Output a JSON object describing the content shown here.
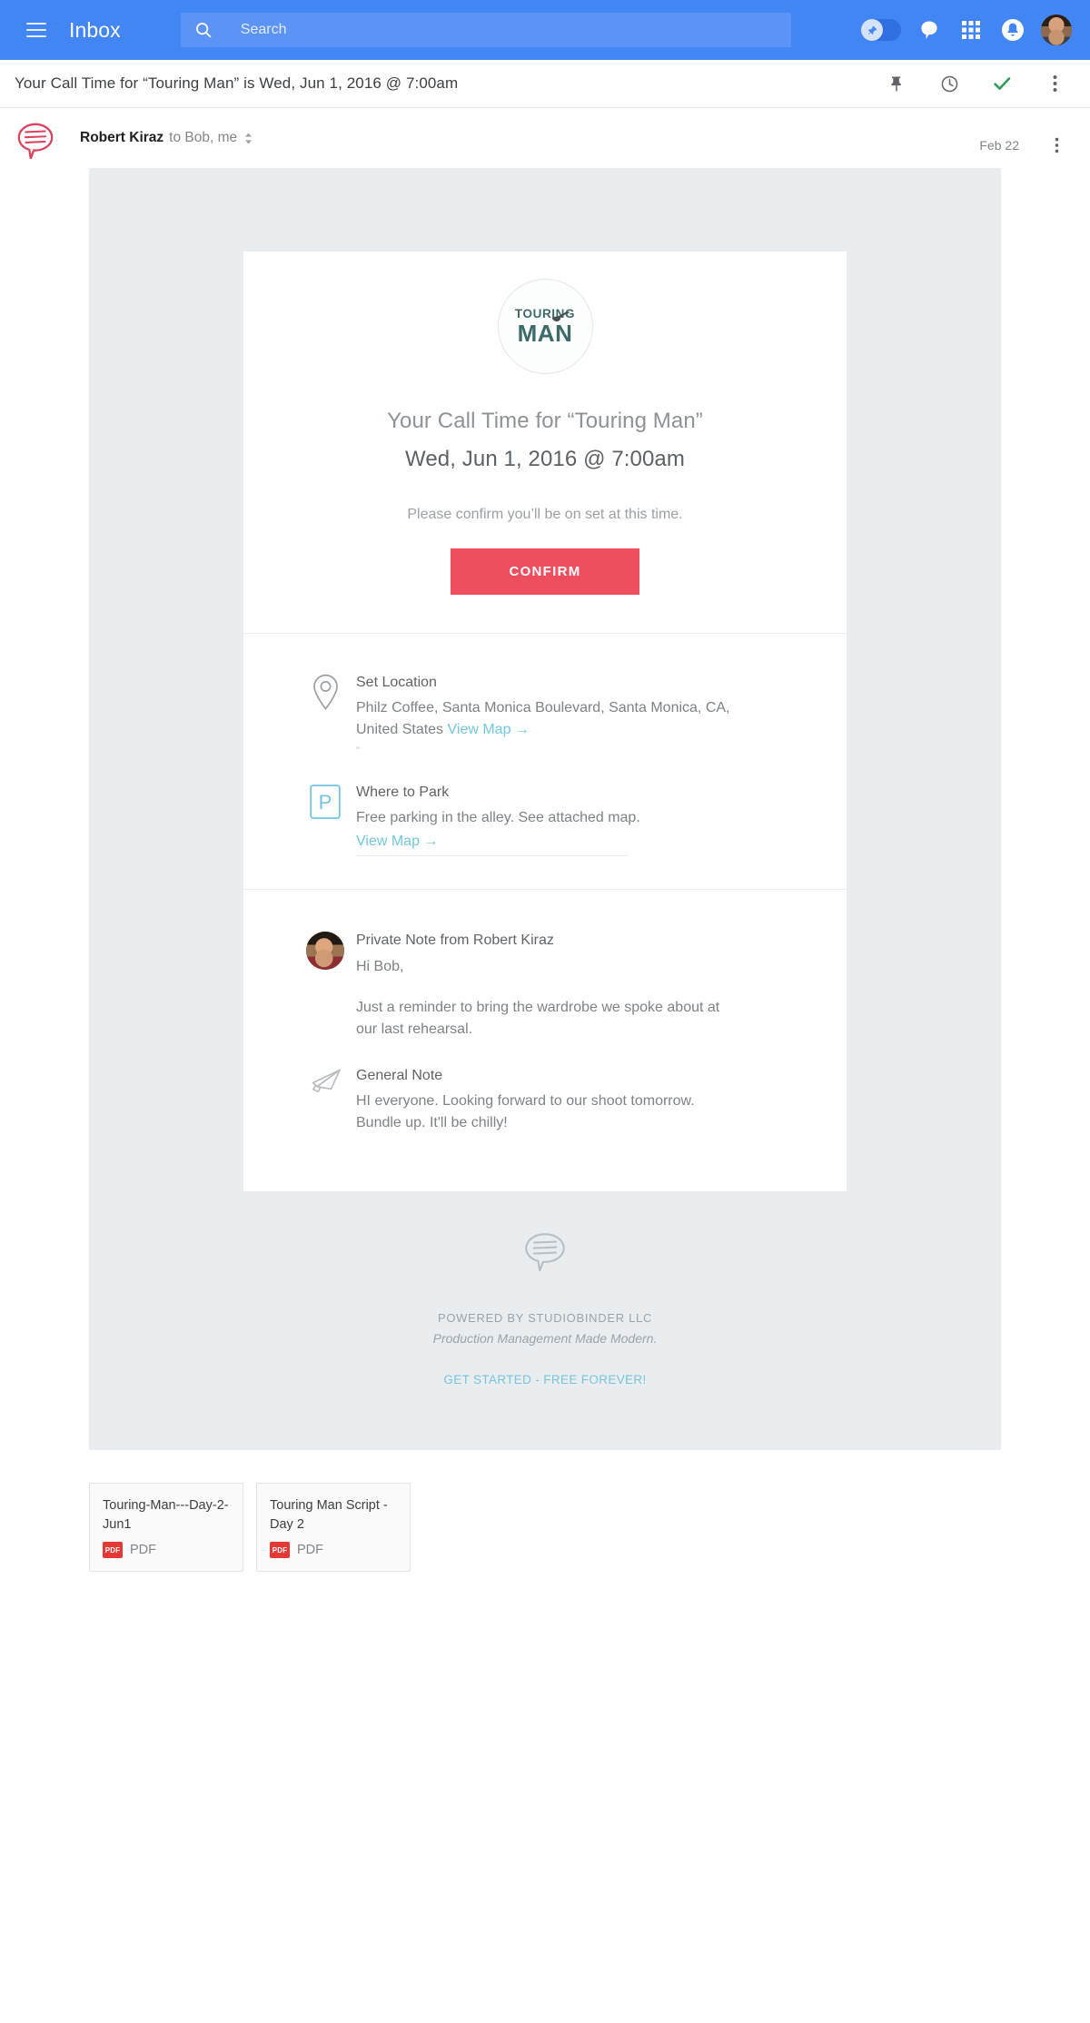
{
  "topbar": {
    "menu_icon": "hamburger-icon",
    "app_title": "Inbox",
    "search": {
      "icon": "search-icon",
      "placeholder": "Search",
      "value": ""
    },
    "pin_toggle": {
      "icon": "pin-icon",
      "state": "on"
    },
    "hangouts_icon": "chat-bubble-icon",
    "apps_icon": "apps-grid-icon",
    "notifications_icon": "bell-icon",
    "account_avatar": "user-avatar",
    "brand_color": "#4285f4"
  },
  "subject_bar": {
    "title": "Your Call Time for “Touring Man” is Wed, Jun 1, 2016 @ 7:00am",
    "actions": [
      {
        "name": "pin-icon",
        "label": "Pin"
      },
      {
        "name": "snooze-clock-icon",
        "label": "Snooze"
      },
      {
        "name": "done-check-icon",
        "label": "Done",
        "color": "#2e9e5b"
      },
      {
        "name": "more-options-icon",
        "label": "More"
      }
    ]
  },
  "message": {
    "sender_avatar": "studiobinder-bubble-logo",
    "sender_name": "Robert Kiraz",
    "recipients": "to Bob, me",
    "expand_icon": "expand-details-icon",
    "date": "Feb 22",
    "more_icon": "more-options-icon"
  },
  "email": {
    "background_color": "#e9edf0",
    "logo": {
      "line1": "TOURING",
      "line2": "MAN",
      "accent": "#3d6b69",
      "icon": "guitar-icon"
    },
    "headline": "Your Call Time for “Touring Man”",
    "headline_date": "Wed, Jun 1, 2016 @ 7:00am",
    "confirm_prompt": "Please confirm you’ll be on set at this time.",
    "confirm_button": "CONFIRM",
    "confirm_button_color": "#ef4e5e",
    "link_color": "#72c6dd",
    "info_rows": [
      {
        "icon": "map-pin-icon",
        "title": "Set Location",
        "text": "Philz Coffee, Santa Monica Boulevard, Santa Monica, CA, United States ",
        "link": "View Map →",
        "footnote": "\""
      },
      {
        "icon": "parking-p-icon",
        "title": "Where to Park",
        "text": "Free parking in the alley. See attached map.",
        "link": "View Map →"
      }
    ],
    "notes": [
      {
        "icon": "sender-photo-avatar",
        "title": "Private Note from Robert Kiraz",
        "greeting": "Hi Bob,",
        "body": "Just a reminder to bring the wardrobe we spoke about at our last rehearsal."
      },
      {
        "icon": "megaphone-icon",
        "title": "General Note",
        "body": "HI everyone. Looking forward to our shoot tomorrow. Bundle up. It'll be chilly!"
      }
    ],
    "footer": {
      "logo_icon": "studiobinder-bubble-logo",
      "powered_by": "POWERED BY STUDIOBINDER LLC",
      "tagline": "Production Management Made Modern.",
      "cta": "GET STARTED - FREE FOREVER!"
    }
  },
  "attachments": [
    {
      "name": "Touring-Man---Day-2-Jun1",
      "type": "PDF",
      "badge": "PDF",
      "badge_color": "#e53935"
    },
    {
      "name": "Touring Man Script - Day 2",
      "type": "PDF",
      "badge": "PDF",
      "badge_color": "#e53935"
    }
  ]
}
